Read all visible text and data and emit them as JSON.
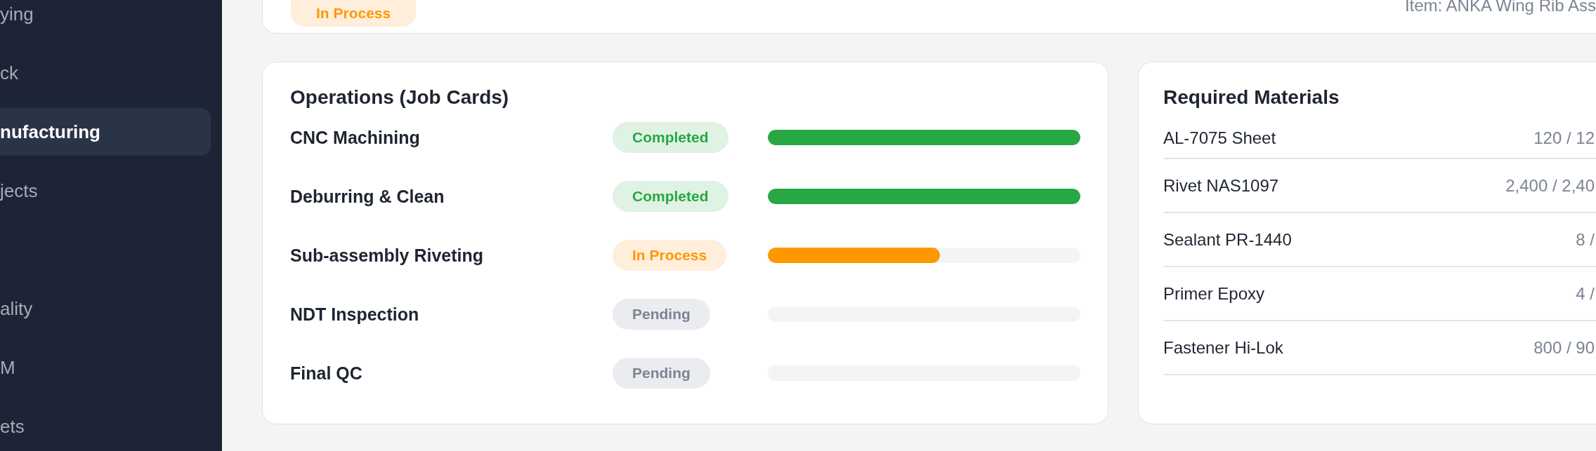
{
  "sidebar": {
    "items": [
      {
        "label": "ying",
        "selected": false
      },
      {
        "label": "ck",
        "selected": false
      },
      {
        "label": "nufacturing",
        "selected": true
      },
      {
        "label": "jects",
        "selected": false
      },
      {
        "label": "ality",
        "selected": false
      },
      {
        "label": "M",
        "selected": false
      },
      {
        "label": "ets",
        "selected": false
      }
    ]
  },
  "order_card": {
    "status": {
      "label": "In Process",
      "kind": "in_process"
    },
    "item": "Item: ANKA Wing Rib Ass"
  },
  "operations": {
    "title": "Operations (Job Cards)",
    "rows": [
      {
        "name": "CNC Machining",
        "status": "Completed",
        "kind": "completed",
        "level": 1
      },
      {
        "name": "Deburring & Clean",
        "status": "Completed",
        "kind": "completed",
        "level": 1
      },
      {
        "name": "Sub-assembly Riveting",
        "status": "In Process",
        "kind": "in_process",
        "level": 0.55
      },
      {
        "name": "NDT Inspection",
        "status": "Pending",
        "kind": "pending",
        "level": 0
      },
      {
        "name": "Final QC",
        "status": "Pending",
        "kind": "pending",
        "level": 0
      }
    ]
  },
  "materials": {
    "title": "Required Materials",
    "rows": [
      {
        "name": "AL-7075 Sheet",
        "quantity": "120 / 12"
      },
      {
        "name": "Rivet NAS1097",
        "quantity": "2,400 / 2,40"
      },
      {
        "name": "Sealant PR-1440",
        "quantity": "8 /"
      },
      {
        "name": "Primer Epoxy",
        "quantity": "4 /"
      },
      {
        "name": "Fastener Hi-Lok",
        "quantity": "800 / 90"
      }
    ]
  }
}
